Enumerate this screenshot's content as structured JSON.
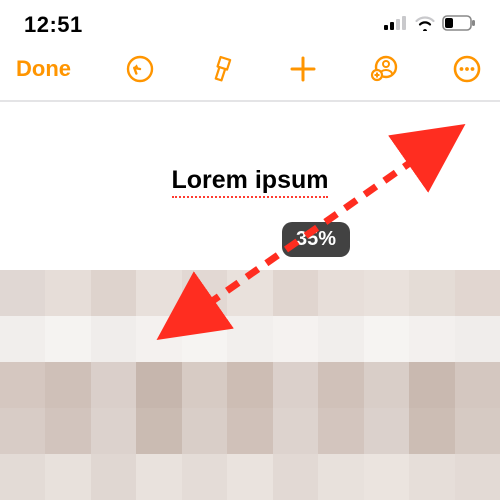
{
  "status": {
    "time": "12:51"
  },
  "toolbar": {
    "done_label": "Done"
  },
  "document": {
    "title": "Lorem ipsum",
    "zoom_label": "35%"
  },
  "colors": {
    "accent": "#ff9500",
    "arrow": "#ff2d20"
  }
}
